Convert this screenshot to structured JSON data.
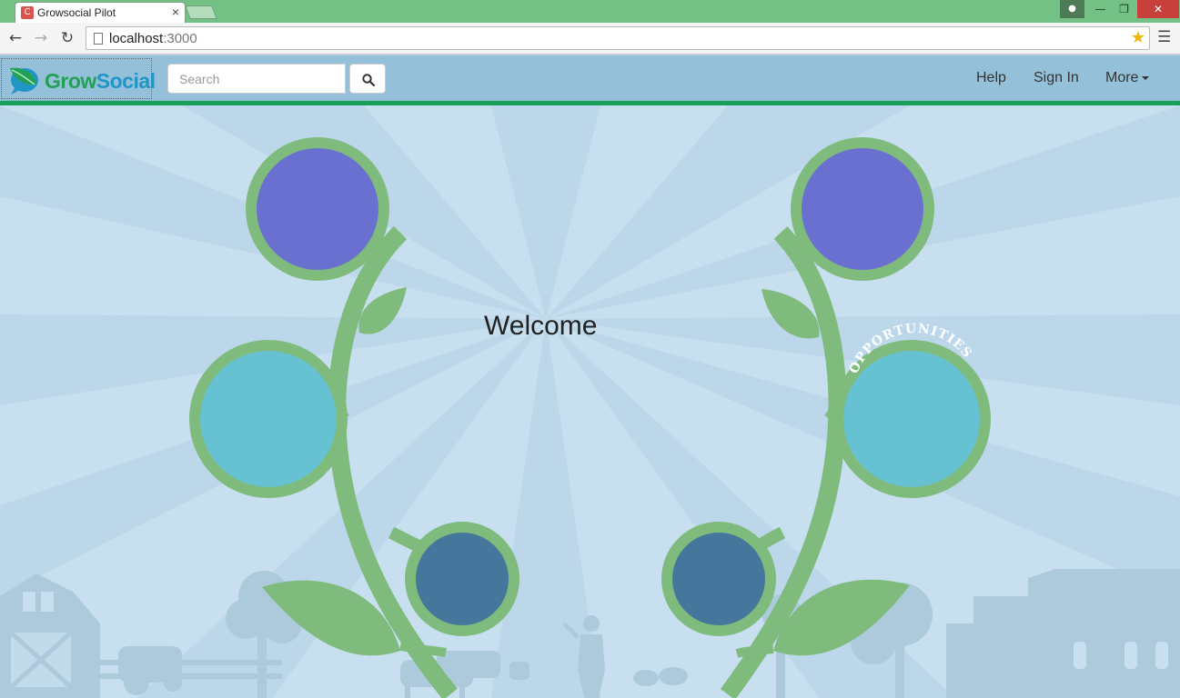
{
  "browser": {
    "tab_title": "Growsocial Pilot",
    "tab_favicon_letter": "C",
    "tab_close": "×",
    "url_host": "localhost",
    "url_port": ":3000"
  },
  "navbar": {
    "brand_part1": "Grow",
    "brand_part2": "Social",
    "search_placeholder": "Search",
    "links": {
      "help": "Help",
      "sign_in": "Sign In",
      "more": "More"
    }
  },
  "hero": {
    "welcome": "Welcome",
    "opportunities_label": "OPPORTUNITIES"
  },
  "colors": {
    "navbar_bg": "#95c0da",
    "navbar_accent": "#18a05a",
    "stem_green": "#7fbb7c",
    "flower_purple": "#6a70d0",
    "flower_teal": "#66c2d2",
    "flower_blue": "#45779d",
    "sky": "#c7dfee"
  }
}
